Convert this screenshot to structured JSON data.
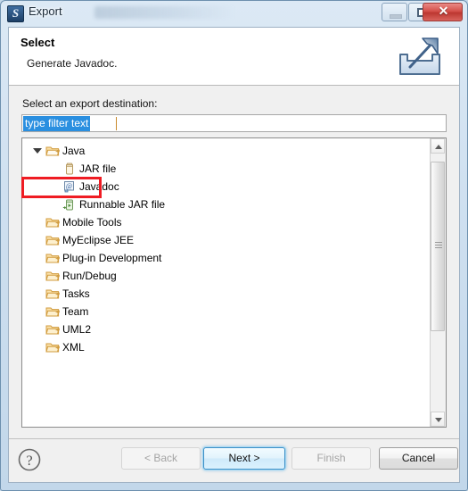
{
  "window": {
    "title": "Export",
    "icon": "eclipse-export-icon",
    "controls": {
      "minimize": "minimize-icon",
      "maximize": "restore-icon",
      "close": "✕"
    }
  },
  "header": {
    "title": "Select",
    "description": "Generate Javadoc.",
    "icon": "export-wizard-icon"
  },
  "body": {
    "destination_label": "Select an export destination:",
    "filter": {
      "value": "type filter text",
      "placeholder": "type filter text",
      "selected": true
    },
    "tree": [
      {
        "label": "Java",
        "level": 0,
        "state": "expanded",
        "icon": "folder-open-icon"
      },
      {
        "label": "JAR file",
        "level": 1,
        "state": "leaf",
        "icon": "jar-file-icon"
      },
      {
        "label": "Javadoc",
        "level": 1,
        "state": "leaf",
        "icon": "javadoc-icon",
        "highlighted": true
      },
      {
        "label": "Runnable JAR file",
        "level": 1,
        "state": "leaf",
        "icon": "runnable-jar-icon"
      },
      {
        "label": "Mobile Tools",
        "level": 0,
        "state": "collapsed",
        "icon": "folder-icon"
      },
      {
        "label": "MyEclipse JEE",
        "level": 0,
        "state": "collapsed",
        "icon": "folder-icon"
      },
      {
        "label": "Plug-in Development",
        "level": 0,
        "state": "collapsed",
        "icon": "folder-icon"
      },
      {
        "label": "Run/Debug",
        "level": 0,
        "state": "collapsed",
        "icon": "folder-icon"
      },
      {
        "label": "Tasks",
        "level": 0,
        "state": "collapsed",
        "icon": "folder-icon"
      },
      {
        "label": "Team",
        "level": 0,
        "state": "collapsed",
        "icon": "folder-icon"
      },
      {
        "label": "UML2",
        "level": 0,
        "state": "collapsed",
        "icon": "folder-icon"
      },
      {
        "label": "XML",
        "level": 0,
        "state": "collapsed",
        "icon": "folder-icon"
      }
    ],
    "annotation_color": "#ef1c23"
  },
  "footer": {
    "help_label": "?",
    "back_label": "< Back",
    "next_label": "Next >",
    "finish_label": "Finish",
    "cancel_label": "Cancel"
  },
  "colors": {
    "selection_blue": "#2a8fe0",
    "default_button_border": "#3c8fc7",
    "annotation_red": "#ef1c23",
    "close_button_red": "#cc4a44"
  }
}
